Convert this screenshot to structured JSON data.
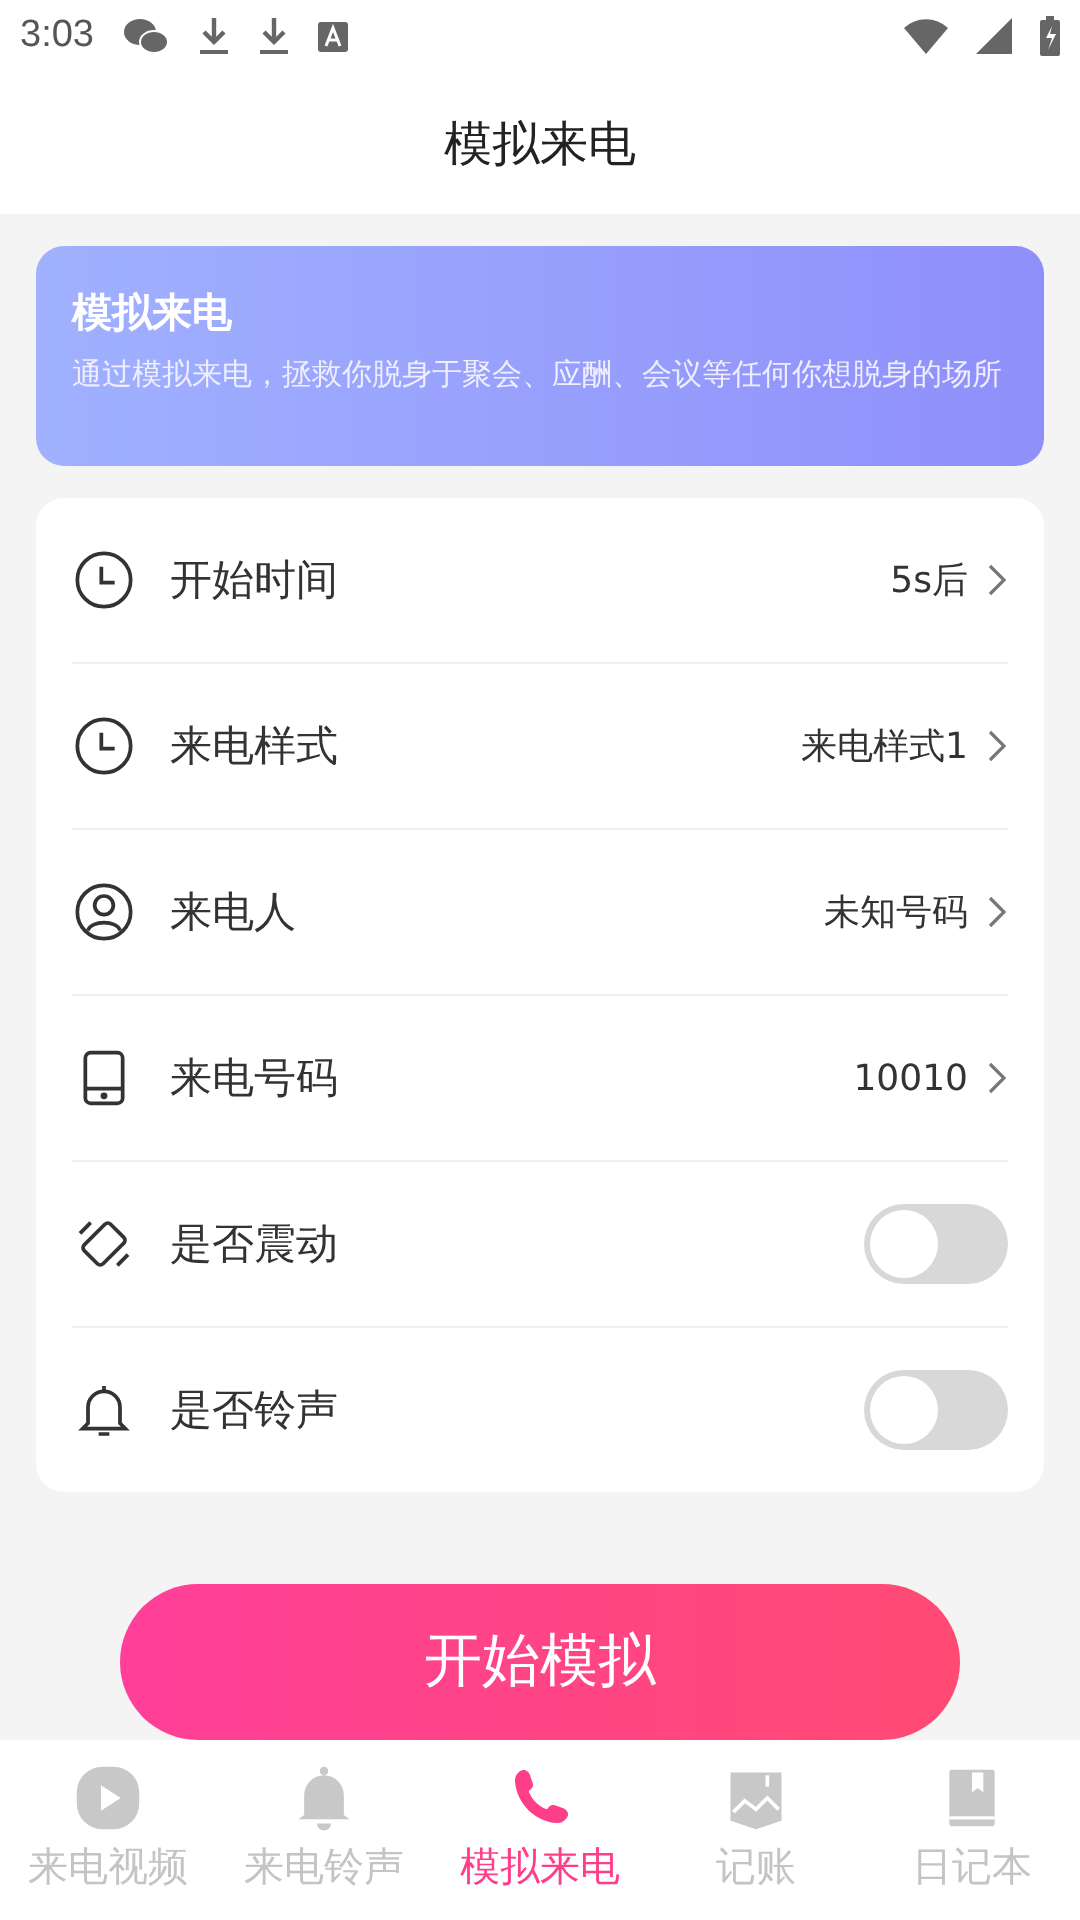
{
  "status_bar": {
    "time": "3:03"
  },
  "header": {
    "title": "模拟来电"
  },
  "banner": {
    "title": "模拟来电",
    "description": "通过模拟来电，拯救你脱身于聚会、应酬、会议等任何你想脱身的场所"
  },
  "settings": [
    {
      "kind": "link",
      "label": "开始时间",
      "value": "5s后"
    },
    {
      "kind": "link",
      "label": "来电样式",
      "value": "来电样式1"
    },
    {
      "kind": "link",
      "label": "来电人",
      "value": "未知号码"
    },
    {
      "kind": "link",
      "label": "来电号码",
      "value": "10010"
    },
    {
      "kind": "toggle",
      "label": "是否震动",
      "on": false
    },
    {
      "kind": "toggle",
      "label": "是否铃声",
      "on": false
    }
  ],
  "start_button": {
    "label": "开始模拟"
  },
  "tab_bar": [
    {
      "label": "来电视频",
      "selected": false
    },
    {
      "label": "来电铃声",
      "selected": false
    },
    {
      "label": "模拟来电",
      "selected": true
    },
    {
      "label": "记账",
      "selected": false
    },
    {
      "label": "日记本",
      "selected": false
    }
  ]
}
